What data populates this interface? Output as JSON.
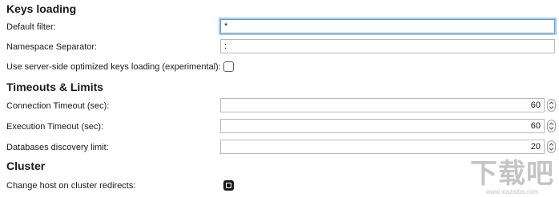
{
  "sections": {
    "keys_loading": {
      "title": "Keys loading",
      "default_filter": {
        "label": "Default filter:",
        "value": "*"
      },
      "namespace_separator": {
        "label": "Namespace Separator:",
        "value": ":"
      },
      "server_side_loading": {
        "label": "Use server-side optimized keys loading (experimental):",
        "checked": false
      }
    },
    "timeouts": {
      "title": "Timeouts & Limits",
      "connection_timeout": {
        "label": "Connection Timeout (sec):",
        "value": "60"
      },
      "execution_timeout": {
        "label": "Execution Timeout (sec):",
        "value": "60"
      },
      "databases_discovery_limit": {
        "label": "Databases discovery limit:",
        "value": "20"
      }
    },
    "cluster": {
      "title": "Cluster",
      "change_host_on_redirects": {
        "label": "Change host on cluster redirects:",
        "checked": true
      }
    }
  },
  "watermark": {
    "brand": "下载吧",
    "url": "www.xiazaiba.com"
  },
  "colors": {
    "focus_ring": "#a9ccf0",
    "focus_border": "#5b9ddd",
    "input_border": "#b9b9b9"
  }
}
